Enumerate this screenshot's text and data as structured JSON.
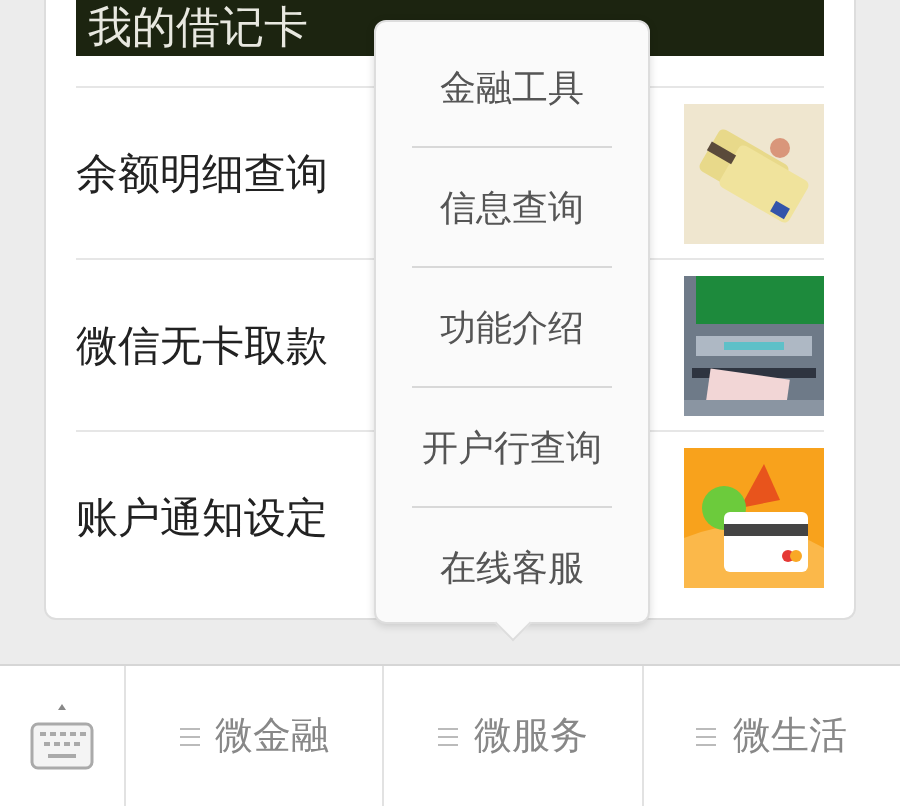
{
  "header": {
    "title": "我的借记卡"
  },
  "rows": [
    {
      "label": "余额明细查询",
      "kind": "picture"
    },
    {
      "label": "微信无卡取款",
      "kind": "picture"
    },
    {
      "label": "账户通知设定",
      "kind": "picture"
    }
  ],
  "popup_menu": {
    "items": [
      "金融工具",
      "信息查询",
      "功能介绍",
      "开户行查询",
      "在线客服"
    ]
  },
  "bottom_bar": {
    "tabs": [
      {
        "label": "微金融"
      },
      {
        "label": "微服务"
      },
      {
        "label": "微生活"
      }
    ]
  }
}
